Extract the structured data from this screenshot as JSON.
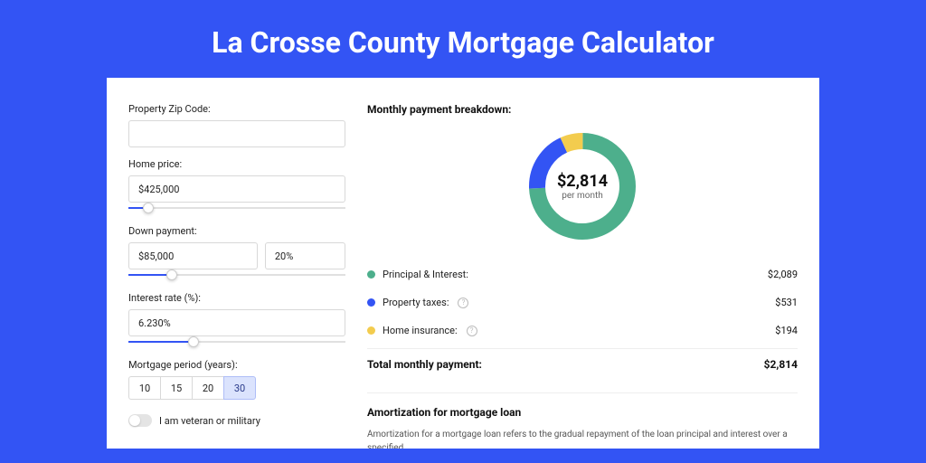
{
  "title": "La Crosse County Mortgage Calculator",
  "form": {
    "zip_label": "Property Zip Code:",
    "zip_value": "",
    "price_label": "Home price:",
    "price_value": "$425,000",
    "price_slider_pct": 9,
    "down_label": "Down payment:",
    "down_value": "$85,000",
    "down_pct_value": "20%",
    "down_slider_pct": 20,
    "rate_label": "Interest rate (%):",
    "rate_value": "6.230%",
    "rate_slider_pct": 30,
    "period_label": "Mortgage period (years):",
    "periods": [
      "10",
      "15",
      "20",
      "30"
    ],
    "period_active": "30",
    "veteran_label": "I am veteran or military"
  },
  "breakdown": {
    "heading": "Monthly payment breakdown:",
    "amount": "$2,814",
    "per": "per month",
    "items": [
      {
        "label": "Principal & Interest:",
        "value": "$2,089",
        "color": "#4DAF8C",
        "help": false
      },
      {
        "label": "Property taxes:",
        "value": "$531",
        "color": "#3354F4",
        "help": true
      },
      {
        "label": "Home insurance:",
        "value": "$194",
        "color": "#F3CC4E",
        "help": true
      }
    ],
    "total_label": "Total monthly payment:",
    "total_value": "$2,814"
  },
  "chart_data": {
    "type": "pie",
    "title": "Monthly payment breakdown",
    "categories": [
      "Principal & Interest",
      "Property taxes",
      "Home insurance"
    ],
    "values": [
      2089,
      531,
      194
    ],
    "colors": [
      "#4DAF8C",
      "#3354F4",
      "#F3CC4E"
    ]
  },
  "amort": {
    "heading": "Amortization for mortgage loan",
    "text": "Amortization for a mortgage loan refers to the gradual repayment of the loan principal and interest over a specified"
  }
}
